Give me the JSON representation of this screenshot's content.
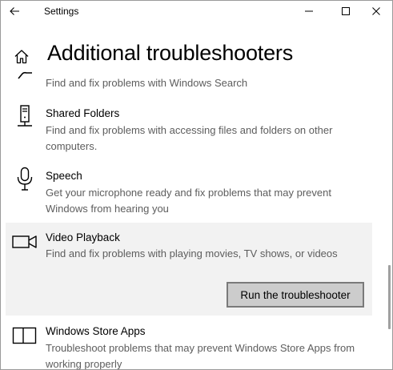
{
  "window": {
    "title": "Settings"
  },
  "header": {
    "page_title": "Additional troubleshooters"
  },
  "icons": {
    "back": "back-arrow-icon",
    "minimize": "minimize-icon",
    "maximize": "maximize-icon",
    "close": "close-icon",
    "home": "home-icon"
  },
  "items": [
    {
      "name": "",
      "description": "Find and fix problems with Windows Search",
      "icon": "search-icon"
    },
    {
      "name": "Shared Folders",
      "description": "Find and fix problems with accessing files and folders on other computers.",
      "icon": "server-icon"
    },
    {
      "name": "Speech",
      "description": "Get your microphone ready and fix problems that may prevent Windows from hearing you",
      "icon": "microphone-icon"
    },
    {
      "name": "Video Playback",
      "description": "Find and fix problems with playing movies, TV shows, or videos",
      "icon": "video-camera-icon",
      "selected": true,
      "button_label": "Run the troubleshooter"
    },
    {
      "name": "Windows Store Apps",
      "description": "Troubleshoot problems that may prevent Windows Store Apps from working properly",
      "icon": "store-apps-icon"
    }
  ],
  "colors": {
    "selected_background": "#f2f2f2",
    "button_background": "#cccccc",
    "button_border": "#7a7a7a",
    "description_text": "#5d5d5d"
  }
}
